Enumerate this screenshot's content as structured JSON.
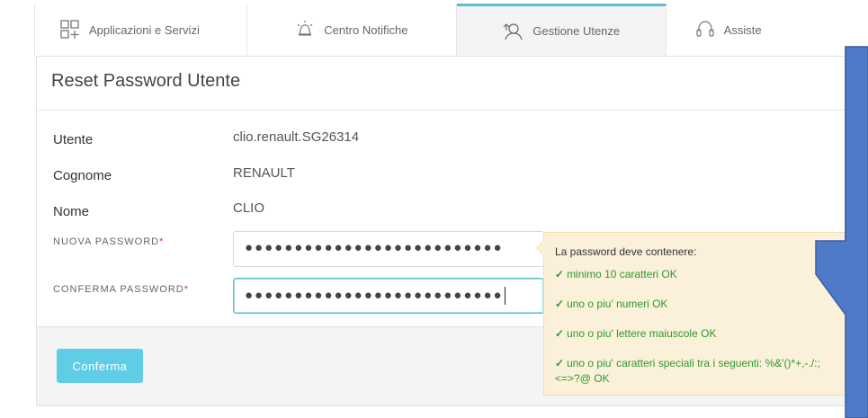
{
  "tabs": [
    {
      "label": "Applicazioni e Servizi",
      "icon": "apps-grid-icon",
      "active": false
    },
    {
      "label": "Centro Notifiche",
      "icon": "bell-icon",
      "active": false
    },
    {
      "label": "Gestione Utenze",
      "icon": "user-manage-icon",
      "active": true
    },
    {
      "label": "Assiste",
      "icon": "headset-icon",
      "active": false
    }
  ],
  "panel": {
    "title": "Reset Password Utente",
    "fields": {
      "utente": {
        "label": "Utente",
        "value": "clio.renault.SG26314"
      },
      "cognome": {
        "label": "Cognome",
        "value": "RENAULT"
      },
      "nome": {
        "label": "Nome",
        "value": "CLIO"
      }
    },
    "new_password": {
      "label": "NUOVA PASSWORD",
      "required": "*",
      "value": "●●●●●●●●●●●●●●●●●●●●●●●●●●"
    },
    "confirm_password": {
      "label": "CONFERMA PASSWORD",
      "required": "*",
      "value": "●●●●●●●●●●●●●●●●●●●●●●●●●●"
    }
  },
  "footer": {
    "confirm_label": "Conferma"
  },
  "tooltip": {
    "title": "La password deve contenere:",
    "check": "✓",
    "items": [
      "minimo 10 caratteri OK",
      "uno o piu' numeri OK",
      "uno o piu' lettere maiuscole OK",
      "uno o piu' caratteri speciali tra i seguenti: %&'()*+,-./:;<=>?@ OK"
    ]
  },
  "colors": {
    "accent": "#5ec0cf",
    "button": "#5fcde5",
    "ok_green": "#2f9a2f",
    "arrow_fill": "#4f7ac7"
  }
}
